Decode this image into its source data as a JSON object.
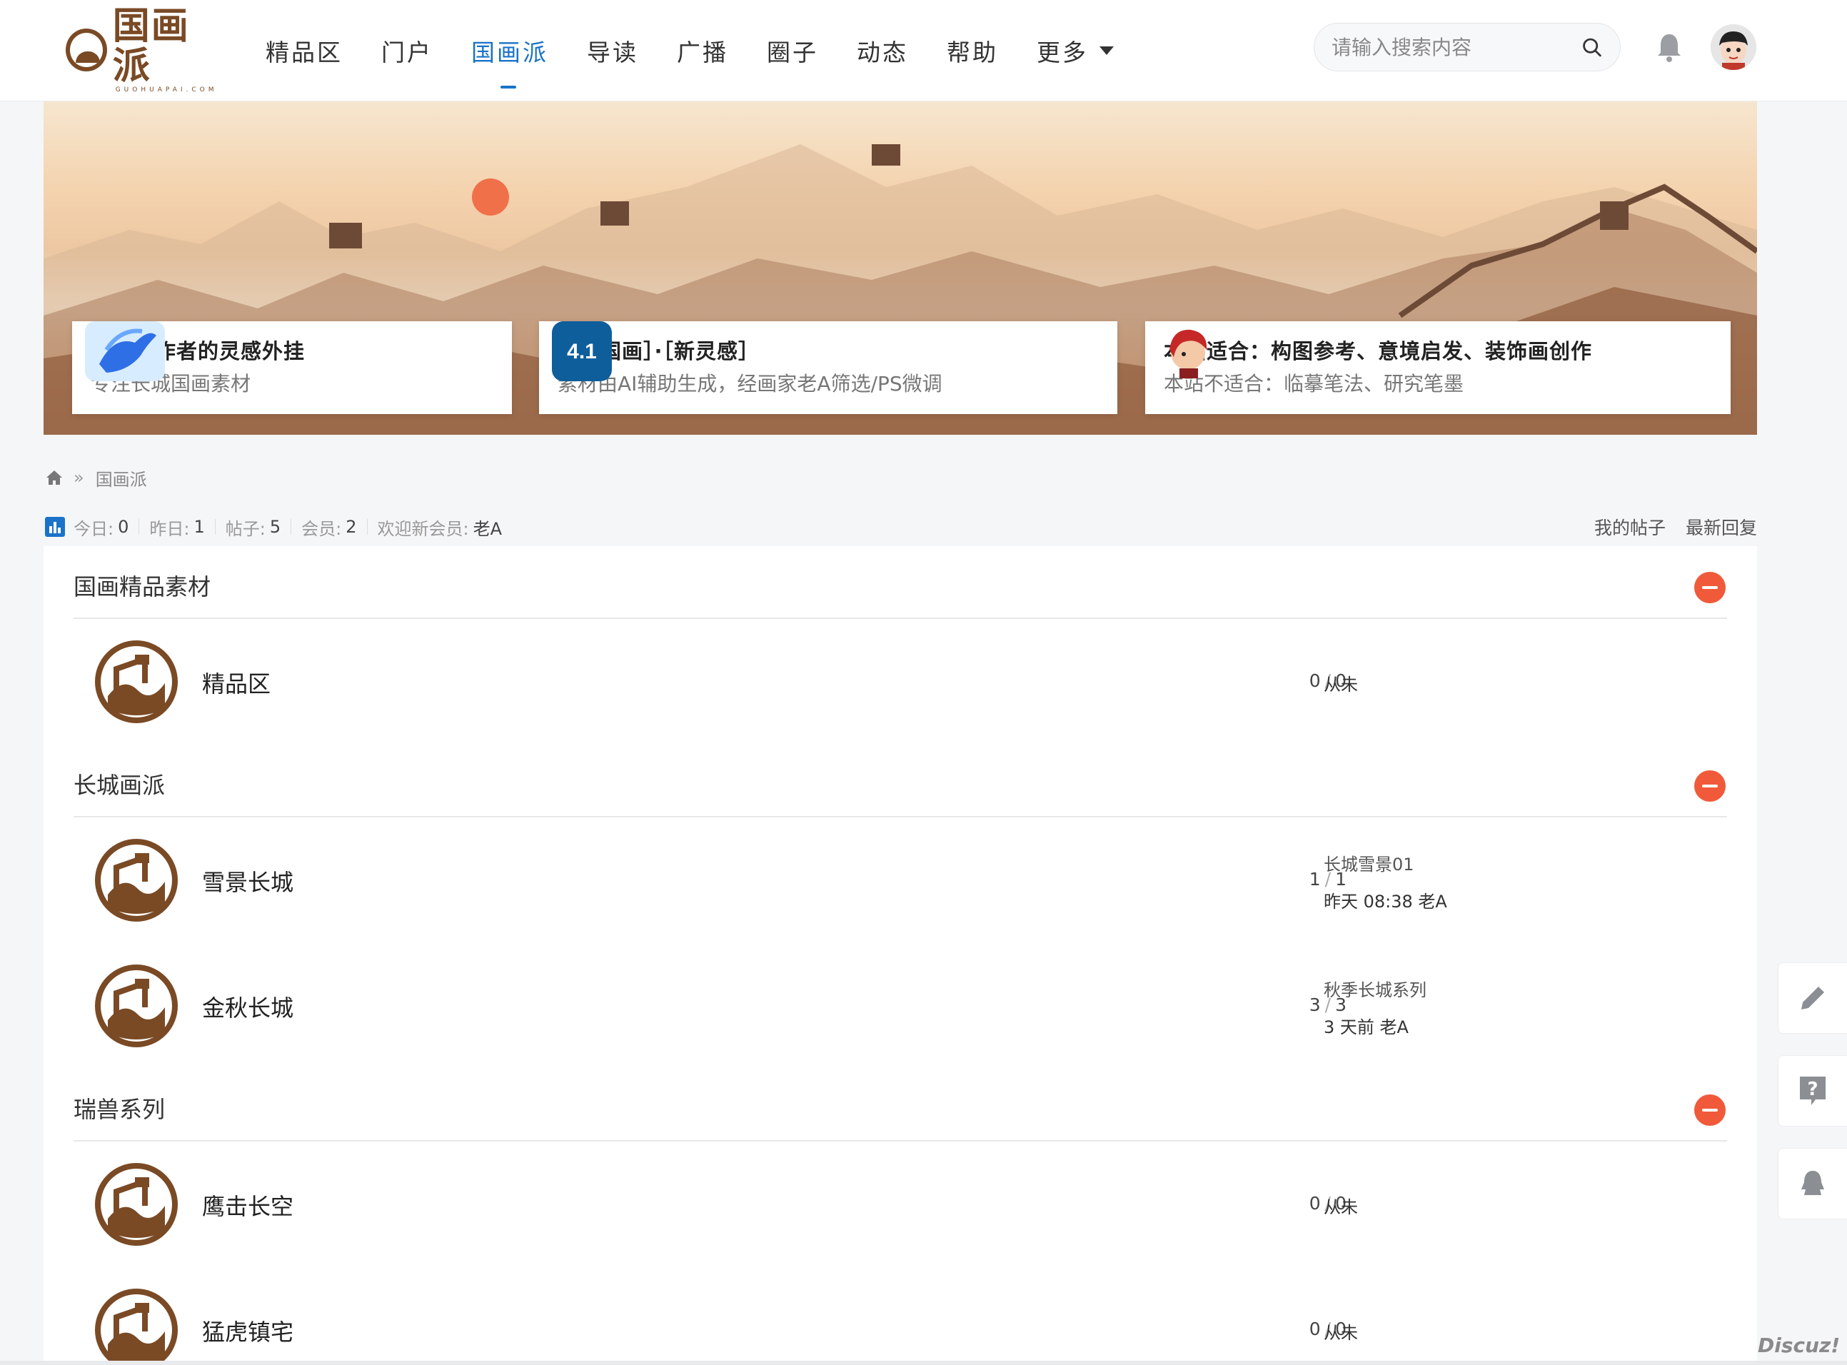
{
  "header": {
    "logo_text": "国画派",
    "logo_sub": "GUOHUAPAI.COM",
    "nav": [
      {
        "label": "精品区"
      },
      {
        "label": "门户"
      },
      {
        "label": "国画派"
      },
      {
        "label": "导读"
      },
      {
        "label": "广播"
      },
      {
        "label": "圈子"
      },
      {
        "label": "动态"
      },
      {
        "label": "帮助"
      },
      {
        "label": "更多"
      }
    ],
    "active_nav": "国画派",
    "search_placeholder": "请输入搜索内容"
  },
  "banner": {
    "cards": [
      {
        "title": "国画创作者的灵感外挂",
        "subtitle": "专注长城国画素材",
        "icon": "pegasus-icon"
      },
      {
        "title": "［新国画］·［新灵感］",
        "subtitle": "素材由AI辅助生成，经画家老A筛选/PS微调",
        "icon": "app-4-1-icon",
        "icon_text": "4.1"
      },
      {
        "title": "本站适合：构图参考、意境启发、装饰画创作",
        "subtitle": "本站不适合：临摹笔法、研究笔墨",
        "icon": "red-hair-character-icon"
      }
    ]
  },
  "breadcrumb": {
    "separator": "»",
    "current": "国画派"
  },
  "stats": {
    "today_label": "今日:",
    "today": "0",
    "yesterday_label": "昨日:",
    "yesterday": "1",
    "posts_label": "帖子:",
    "posts": "5",
    "members_label": "会员:",
    "members": "2",
    "newest_label": "欢迎新会员:",
    "newest": "老A"
  },
  "toplinks": {
    "my_posts": "我的帖子",
    "latest_reply": "最新回复"
  },
  "categories": [
    {
      "title": "国画精品素材",
      "forums": [
        {
          "name": "精品区",
          "threads": "0",
          "posts": "0",
          "last": "从未"
        }
      ]
    },
    {
      "title": "长城画派",
      "forums": [
        {
          "name": "雪景长城",
          "threads": "1",
          "posts": "1",
          "last_title": "长城雪景01",
          "last": "昨天 08:38 老A"
        },
        {
          "name": "金秋长城",
          "threads": "3",
          "posts": "3",
          "last_title": "秋季长城系列",
          "last": "3 天前 老A"
        }
      ]
    },
    {
      "title": "瑞兽系列",
      "forums": [
        {
          "name": "鹰击长空",
          "threads": "0",
          "posts": "0",
          "last": "从未"
        },
        {
          "name": "猛虎镇宅",
          "threads": "0",
          "posts": "0",
          "last": "从未"
        }
      ]
    }
  ],
  "slash": "/",
  "watermark": "Discuz!",
  "colors": {
    "accent": "#1a73c8",
    "brand": "#7a4a25",
    "collapse": "#f05a3a"
  }
}
